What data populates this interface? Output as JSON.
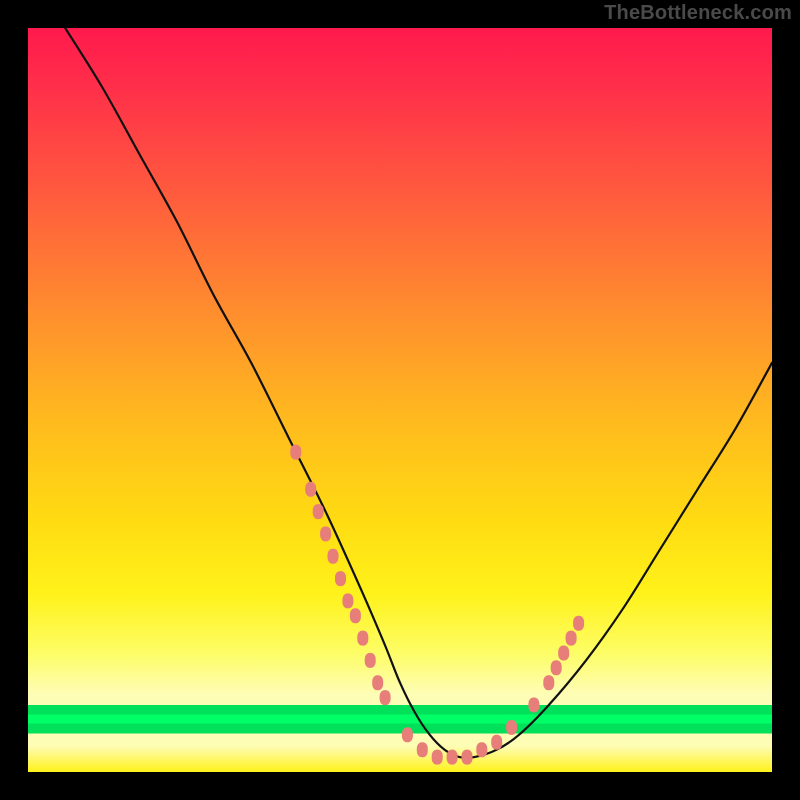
{
  "watermark": "TheBottleneck.com",
  "colors": {
    "background": "#000000",
    "curve": "#111111",
    "marker": "#e77e79",
    "gradient_stops": [
      "#ff1a4d",
      "#ff5a3e",
      "#ffb81f",
      "#fff21a",
      "#fefdb5",
      "#00e05a",
      "#00ff66"
    ]
  },
  "chart_data": {
    "type": "line",
    "title": "",
    "xlabel": "",
    "ylabel": "",
    "xlim": [
      0,
      100
    ],
    "ylim": [
      0,
      100
    ],
    "grid": false,
    "legend": false,
    "series": [
      {
        "name": "bottleneck-curve",
        "x": [
          5,
          10,
          15,
          20,
          25,
          30,
          35,
          40,
          45,
          48,
          50,
          52,
          54,
          56,
          58,
          60,
          63,
          66,
          70,
          75,
          80,
          85,
          90,
          95,
          100
        ],
        "values": [
          100,
          92,
          83,
          74,
          64,
          55,
          45,
          35,
          24,
          17,
          12,
          8,
          5,
          3,
          2,
          2,
          3,
          5,
          9,
          15,
          22,
          30,
          38,
          46,
          55
        ]
      }
    ],
    "annotations": {
      "markers_note": "salmon markers cluster along both flanks of the valley near the bottom (roughly y ≤ 22) and along the trough",
      "marker_points": [
        {
          "x": 36,
          "y": 43
        },
        {
          "x": 38,
          "y": 38
        },
        {
          "x": 39,
          "y": 35
        },
        {
          "x": 40,
          "y": 32
        },
        {
          "x": 41,
          "y": 29
        },
        {
          "x": 42,
          "y": 26
        },
        {
          "x": 43,
          "y": 23
        },
        {
          "x": 44,
          "y": 21
        },
        {
          "x": 45,
          "y": 18
        },
        {
          "x": 46,
          "y": 15
        },
        {
          "x": 47,
          "y": 12
        },
        {
          "x": 48,
          "y": 10
        },
        {
          "x": 51,
          "y": 5
        },
        {
          "x": 53,
          "y": 3
        },
        {
          "x": 55,
          "y": 2
        },
        {
          "x": 57,
          "y": 2
        },
        {
          "x": 59,
          "y": 2
        },
        {
          "x": 61,
          "y": 3
        },
        {
          "x": 63,
          "y": 4
        },
        {
          "x": 65,
          "y": 6
        },
        {
          "x": 68,
          "y": 9
        },
        {
          "x": 70,
          "y": 12
        },
        {
          "x": 71,
          "y": 14
        },
        {
          "x": 72,
          "y": 16
        },
        {
          "x": 73,
          "y": 18
        },
        {
          "x": 74,
          "y": 20
        }
      ]
    }
  }
}
